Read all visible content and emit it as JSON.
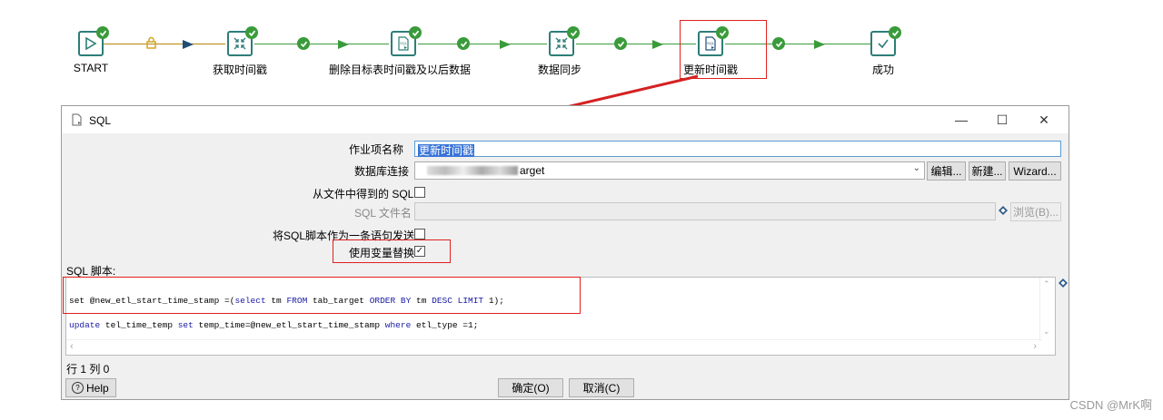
{
  "workflow": {
    "nodes": [
      {
        "label": "START",
        "icon": "start-triangle-icon"
      },
      {
        "label": "获取时间戳",
        "icon": "merge-arrows-icon"
      },
      {
        "label": "删除目标表时间戳及以后数据",
        "icon": "sql-script-icon"
      },
      {
        "label": "数据同步",
        "icon": "merge-arrows-icon"
      },
      {
        "label": "更新时间戳",
        "icon": "sql-script-icon"
      },
      {
        "label": "成功",
        "icon": "success-check-icon"
      }
    ],
    "colors": {
      "hop": "#3a9b3a",
      "node_border": "#2d7d78",
      "highlight": "#e0201e",
      "pointer_arrow": "#d42222"
    }
  },
  "dialog": {
    "title": "SQL",
    "title_icon": "sql-script-icon",
    "window_buttons": {
      "minimize": "—",
      "maximize": "☐",
      "close": "✕"
    },
    "fields": {
      "step_name_label": "作业项名称",
      "step_name_value": "更新时间戳",
      "db_conn_label": "数据库连接",
      "db_conn_value": "arget",
      "edit_button": "编辑...",
      "new_button": "新建...",
      "wizard_button": "Wizard...",
      "sql_from_file_label": "从文件中得到的 SQL",
      "sql_filename_label": "SQL 文件名",
      "browse_button": "浏览(B)...",
      "send_single_label": "将SQL脚本作为一条语句发送",
      "use_var_label": "使用变量替换",
      "use_var_checked": "✓",
      "script_label": "SQL 脚本:"
    },
    "sql": {
      "line1": {
        "p1": "set @new_etl_start_time_stamp =(",
        "p2": "select",
        "p3": " tm ",
        "p4": "FROM",
        "p5": " tab_target ",
        "p6": "ORDER BY",
        "p7": " tm ",
        "p8": "DESC LIMIT",
        "p9": " 1);"
      },
      "line2": {
        "p1": "update",
        "p2": " tel_time_temp ",
        "p3": "set",
        "p4": " temp_time=@new_etl_start_time_stamp ",
        "p5": "where",
        "p6": " etl_type =1;"
      }
    },
    "position_label": "行 1 列 0",
    "help_button": "Help",
    "ok_button": "确定(O)",
    "cancel_button": "取消(C)"
  },
  "watermark": "CSDN @MrK啊"
}
